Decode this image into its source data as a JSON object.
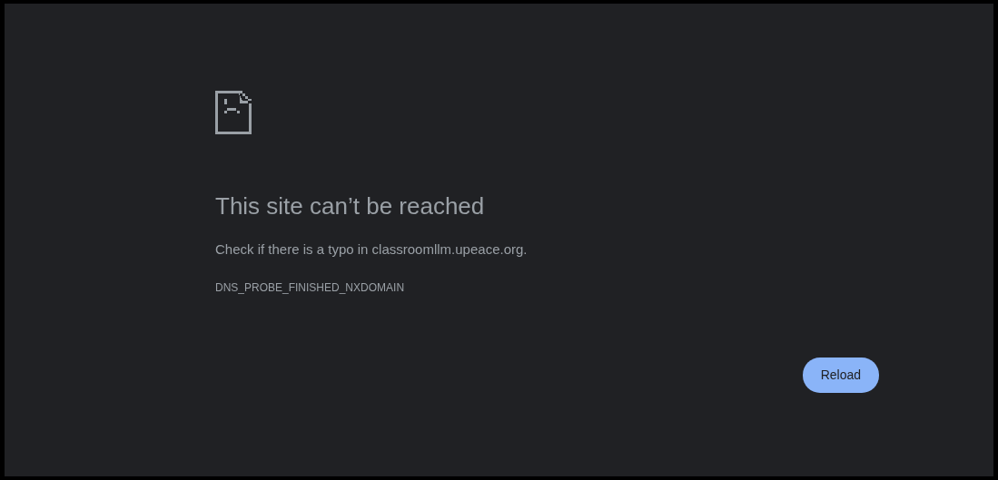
{
  "heading": "This site can’t be reached",
  "message": "Check if there is a typo in classroomllm.upeace.org.",
  "error_code": "DNS_PROBE_FINISHED_NXDOMAIN",
  "buttons": [
    "Reload"
  ]
}
